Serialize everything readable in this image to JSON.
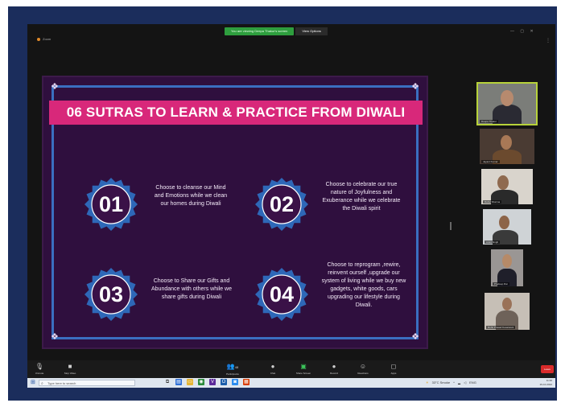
{
  "meeting_bar": {
    "sharing_text": "You are viewing Deepa Thakur's screen",
    "view_options": "View Options"
  },
  "window": {
    "app_title": "Zoom"
  },
  "slide": {
    "title": "06 SUTRAS TO LEARN & PRACTICE FROM DIWALI",
    "colors": {
      "background": "#2f0f3e",
      "banner": "#d8287a",
      "border": "#3a6fc0",
      "badge": "#2e68b8"
    },
    "steps": [
      {
        "number": "01",
        "text": "Choose to cleanse our Mind and Emotions while we clean our homes during Diwali"
      },
      {
        "number": "02",
        "text": "Choose to celebrate our true nature of Joyfulness and Exuberance while we celebrate the Diwali spirit"
      },
      {
        "number": "03",
        "text": "Choose to Share our Gifts and Abundance with others while we share gifts during Diwali"
      },
      {
        "number": "04",
        "text": "Choose to reprogram ,rewire, reinvent ourself ,upgrade our system of living while we buy new gadgets, white goods, cars upgrading our lifestyle during Diwali."
      }
    ]
  },
  "participants": [
    {
      "name": "Deepa Thakur"
    },
    {
      "name": "Jayant Kumar"
    },
    {
      "name": "Rahul Sharma"
    },
    {
      "name": "Ankit Singh"
    },
    {
      "name": "Pradeep Rai"
    },
    {
      "name": "Rohit Prasad Kesarwani"
    }
  ],
  "toolbar": {
    "items": [
      {
        "icon": "microphone-icon",
        "label": "Unmute"
      },
      {
        "icon": "video-camera-icon",
        "label": "Stop Video"
      },
      {
        "icon": "participants-icon",
        "label": "Participants",
        "count": "48"
      },
      {
        "icon": "chat-icon",
        "label": "Chat"
      },
      {
        "icon": "share-screen-icon",
        "label": "Share Screen"
      },
      {
        "icon": "record-icon",
        "label": "Record"
      },
      {
        "icon": "reactions-icon",
        "label": "Reactions"
      },
      {
        "icon": "apps-icon",
        "label": "Apps"
      }
    ],
    "end_label": "Leave"
  },
  "taskbar": {
    "search_placeholder": "Type here to search",
    "weather": "33°C Smoke",
    "language": "ENG",
    "time": "11:36",
    "date": "29-10-2022"
  }
}
